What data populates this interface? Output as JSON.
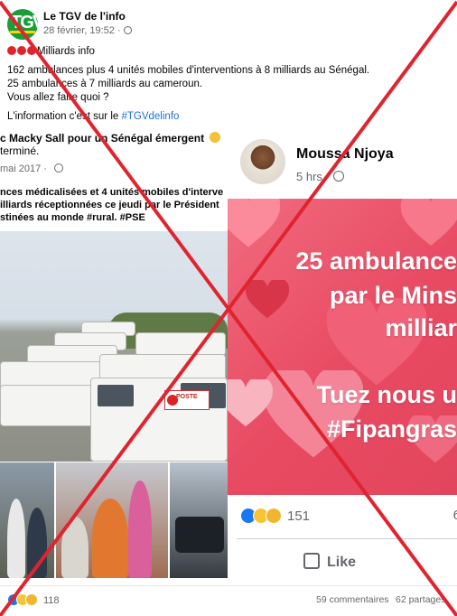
{
  "post": {
    "page_name": "Le TGV de l'info",
    "avatar_text": "TGV",
    "timestamp": "28 février, 19:52 ·",
    "lines": [
      "Milliards info",
      "162 ambulances plus 4 unités mobiles d'interventions à 8 milliards au Sénégal.",
      "25 ambulances à 7 milliards au cameroun.",
      "Vous allez faire quoi ?",
      "L'information c'est sur le "
    ],
    "hashtag": "#TGVdelinfo"
  },
  "left_image": {
    "title": "c Macky Sall pour un Sénégal émergent",
    "title2": "terminé.",
    "date": "mai 2017 ·",
    "text_lines": [
      "nces médicalisées et 4 unités mobiles d'interve",
      "illiards  réceptionnées ce jeudi par le Président",
      "stinées au monde "
    ],
    "hashtags": "#rural. #PSE",
    "poste_label": "POSTE"
  },
  "right_image": {
    "name": "Moussa Njoya",
    "time": "5 hrs ·",
    "card_lines": [
      "25 ambulance",
      "par le Mins",
      "milliar",
      "Tuez nous u",
      "#Fipangras"
    ],
    "reaction_count": "151",
    "comment_count": "6",
    "like_label": "Like"
  },
  "footer": {
    "reaction_count": "118",
    "comments": "59 commentaires",
    "shares": "62 partages"
  },
  "colors": {
    "cross": "#e0242f",
    "card": "#e84a62",
    "link": "#216fdb"
  }
}
